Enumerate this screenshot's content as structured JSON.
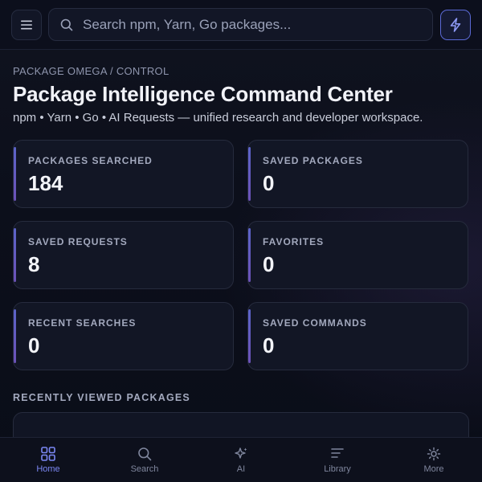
{
  "topbar": {
    "search_placeholder": "Search npm, Yarn, Go packages...",
    "menu_icon": "menu-icon",
    "search_icon": "search-icon",
    "action_icon": "bolt-icon"
  },
  "header": {
    "breadcrumb": "PACKAGE OMEGA / CONTROL",
    "title": "Package Intelligence Command Center",
    "subtitle": "npm • Yarn • Go • AI Requests — unified research and developer workspace."
  },
  "stats": [
    {
      "label": "PACKAGES SEARCHED",
      "value": "184"
    },
    {
      "label": "SAVED PACKAGES",
      "value": "0"
    },
    {
      "label": "SAVED REQUESTS",
      "value": "8"
    },
    {
      "label": "FAVORITES",
      "value": "0"
    },
    {
      "label": "RECENT SEARCHES",
      "value": "0"
    },
    {
      "label": "SAVED COMMANDS",
      "value": "0"
    }
  ],
  "recent": {
    "section_title": "RECENTLY VIEWED PACKAGES"
  },
  "nav": {
    "items": [
      {
        "label": "Home",
        "icon": "grid-icon",
        "active": true
      },
      {
        "label": "Search",
        "icon": "search-icon",
        "active": false
      },
      {
        "label": "AI",
        "icon": "sparkle-icon",
        "active": false
      },
      {
        "label": "Library",
        "icon": "library-icon",
        "active": false
      },
      {
        "label": "More",
        "icon": "gear-icon",
        "active": false
      }
    ]
  },
  "colors": {
    "accent": "#7b87f3",
    "background": "#0b0e1a",
    "card": "#121625"
  }
}
